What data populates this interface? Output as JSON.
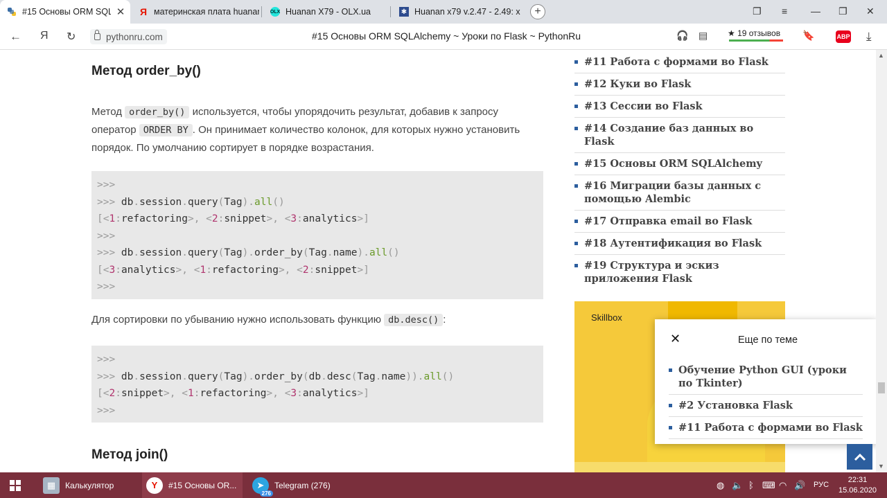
{
  "browser": {
    "tabs": [
      {
        "title": "#15 Основы ORM SQLAlchemy ~ Уроки по Flask ~ PythonRu",
        "icon": "python-icon",
        "active": true
      },
      {
        "title": "материнская плата huanan",
        "icon": "yandex-icon",
        "active": false
      },
      {
        "title": "Huanan X79 - OLX.ua",
        "icon": "olx-icon",
        "active": false
      },
      {
        "title": "Huanan x79 v.2.47 - 2.49: x",
        "icon": "site-icon",
        "active": false
      }
    ],
    "domain": "pythonru.com",
    "page_title": "#15 Основы ORM SQLAlchemy ~ Уроки по Flask ~ PythonRu",
    "reviews": "★ 19 отзывов",
    "adblock_label": "ABP"
  },
  "article": {
    "h_order_by": "Метод order_by()",
    "p1": {
      "t1": "Метод ",
      "c1": "order_by()",
      "t2": " используется, чтобы упорядочить результат, добавив к запросу оператор ",
      "c2": "ORDER BY",
      "t3": ". Он принимает количество колонок, для которых нужно установить порядок. По умолчанию сортирует в порядке возрастания."
    },
    "p2": {
      "t1": "Для сортировки по убыванию нужно использовать функцию ",
      "c1": "db.desc()",
      "t2": ":"
    },
    "h_join": "Метод join()"
  },
  "sidebar": {
    "items": [
      "#11 Работа с формами во Flask",
      "#12 Куки во Flask",
      "#13 Сессии во Flask",
      "#14 Создание баз данных во Flask",
      "#15 Основы ORM SQLAlchemy",
      "#16 Миграции базы данных с помощью Alembic",
      "#17 Отправка email во Flask",
      "#18 Аутентификация во Flask",
      "#19 Структура и эскиз приложения Flask"
    ]
  },
  "ad": {
    "brand": "Skillbox",
    "accent": "#f5c93a"
  },
  "popup": {
    "title": "Еще по теме",
    "items": [
      "Обучение Python GUI (уроки по Tkinter)",
      "#2 Установка Flask",
      "#11 Работа с формами во Flask"
    ]
  },
  "taskbar": {
    "items": [
      {
        "label": "Калькулятор",
        "icon": "calculator-icon"
      },
      {
        "label": "#15 Основы OR...",
        "icon": "yandex-browser-icon"
      },
      {
        "label": "Telegram (276)",
        "icon": "telegram-icon",
        "badge": "276"
      }
    ],
    "lang": "РУС",
    "time": "22:31",
    "date": "15.06.2020"
  },
  "colors": {
    "taskbar": "#7a2f3c",
    "accent_blue": "#2c5e9e",
    "code_bg": "#e8e8e8"
  }
}
